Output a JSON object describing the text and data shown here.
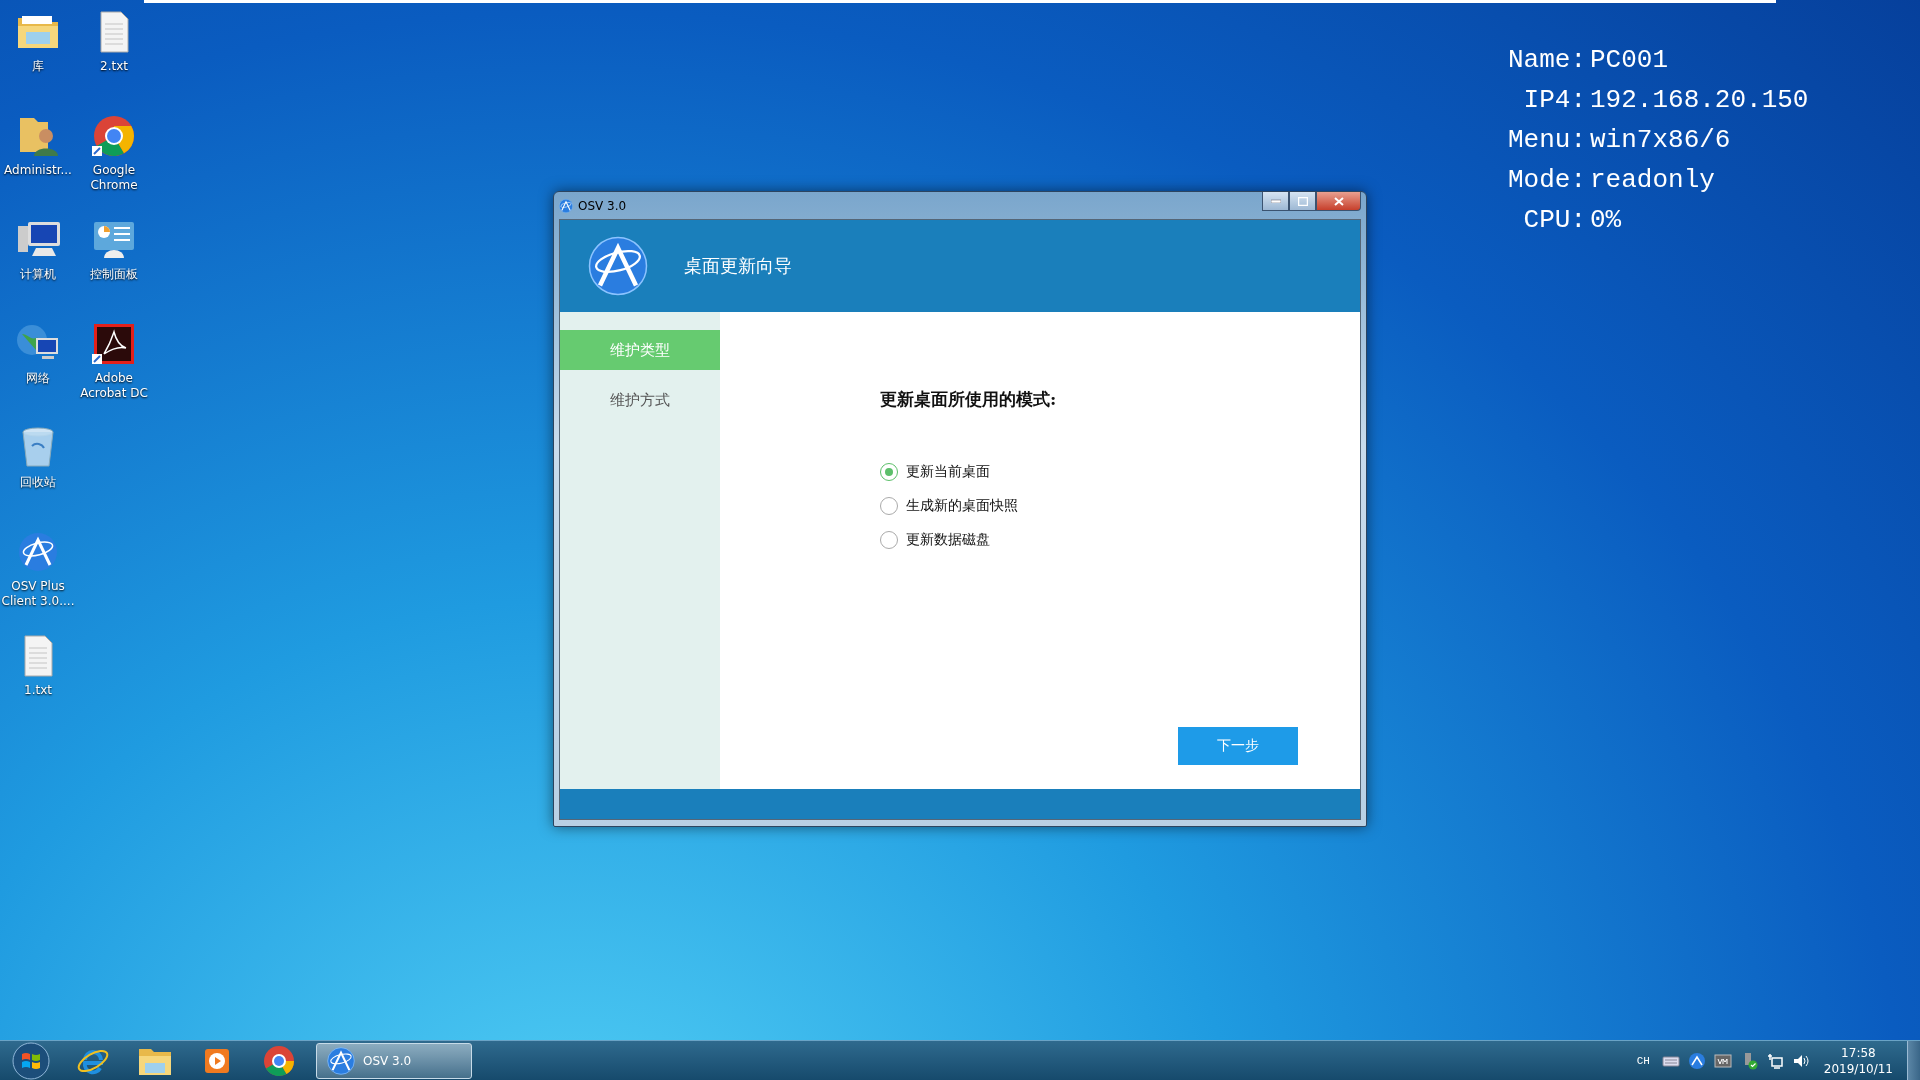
{
  "desktop_icons": [
    {
      "label": "库",
      "kind": "library"
    },
    {
      "label": "Administr...",
      "kind": "user"
    },
    {
      "label": "计算机",
      "kind": "computer"
    },
    {
      "label": "网络",
      "kind": "network"
    },
    {
      "label": "回收站",
      "kind": "recycle"
    },
    {
      "label": "OSV Plus Client 3.0....",
      "kind": "osv"
    },
    {
      "label": "1.txt",
      "kind": "text"
    },
    {
      "label": "2.txt",
      "kind": "text"
    },
    {
      "label": "Google Chrome",
      "kind": "chrome"
    },
    {
      "label": "控制面板",
      "kind": "control"
    },
    {
      "label": "Adobe Acrobat DC",
      "kind": "pdf"
    }
  ],
  "system_info": [
    {
      "label": "Name:",
      "value": "PC001"
    },
    {
      "label": "IP4:",
      "value": "192.168.20.150"
    },
    {
      "label": "Menu:",
      "value": "win7x86/6"
    },
    {
      "label": "Mode:",
      "value": "readonly"
    },
    {
      "label": "CPU:",
      "value": "0%"
    }
  ],
  "window": {
    "title": "OSV 3.0",
    "header_title": "桌面更新向导",
    "steps": [
      {
        "label": "维护类型",
        "selected": true
      },
      {
        "label": "维护方式",
        "selected": false
      }
    ],
    "prompt": "更新桌面所使用的模式:",
    "options": [
      {
        "label": "更新当前桌面",
        "selected": true
      },
      {
        "label": "生成新的桌面快照",
        "selected": false
      },
      {
        "label": "更新数据磁盘",
        "selected": false
      }
    ],
    "next_button": "下一步"
  },
  "taskbar": {
    "active_task": "OSV 3.0",
    "language": "CH",
    "time": "17:58",
    "date": "2019/10/11"
  }
}
